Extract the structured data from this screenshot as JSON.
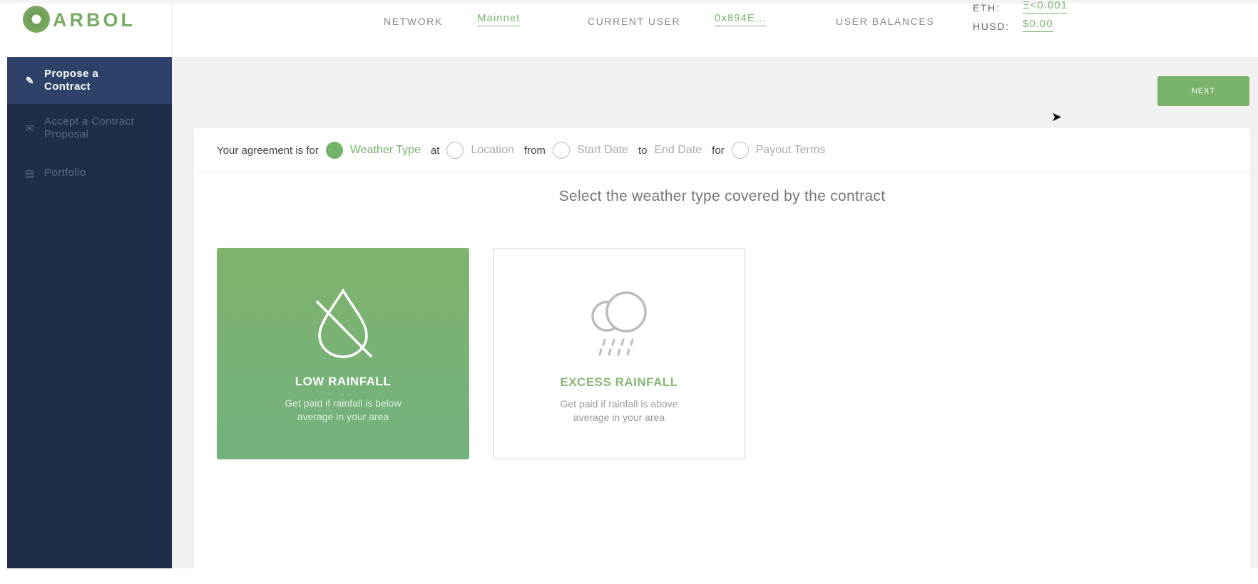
{
  "logo": {
    "text": "ARBOL"
  },
  "header": {
    "network_label": "NETWORK",
    "network_value": "Mainnet",
    "user_label": "CURRENT USER",
    "user_value": "0x894E...",
    "balances_label": "USER BALANCES",
    "eth_label": "ETH:",
    "eth_value": "Ξ<0.001",
    "husd_label": "HUSD:",
    "husd_value": "$0.00"
  },
  "sidebar": {
    "items": [
      {
        "label": "Propose a Contract",
        "icon": "pen-icon",
        "active": true
      },
      {
        "label": "Accept a Contract Proposal",
        "icon": "envelope-icon",
        "active": false
      },
      {
        "label": "Portfolio",
        "icon": "document-icon",
        "active": false
      }
    ]
  },
  "main": {
    "next_label": "NEXT",
    "steps": {
      "intro": "Your agreement is for",
      "weather": "Weather Type",
      "at": "at",
      "location": "Location",
      "from": "from",
      "start": "Start Date",
      "to": "to",
      "end": "End Date",
      "for": "for",
      "payout": "Payout Terms"
    },
    "title": "Select the weather type covered by the contract",
    "options": [
      {
        "title": "LOW RAINFALL",
        "desc": "Get paid if rainfall is below average in your area",
        "icon": "no-drop-icon",
        "selected": true
      },
      {
        "title": "EXCESS RAINFALL",
        "desc": "Get paid if rainfall is above average in your area",
        "icon": "rain-cloud-icon",
        "selected": false
      }
    ]
  },
  "colors": {
    "accent": "#74b36b",
    "sidebar": "#1f2d4b",
    "sidebar_active": "#2e4169"
  }
}
